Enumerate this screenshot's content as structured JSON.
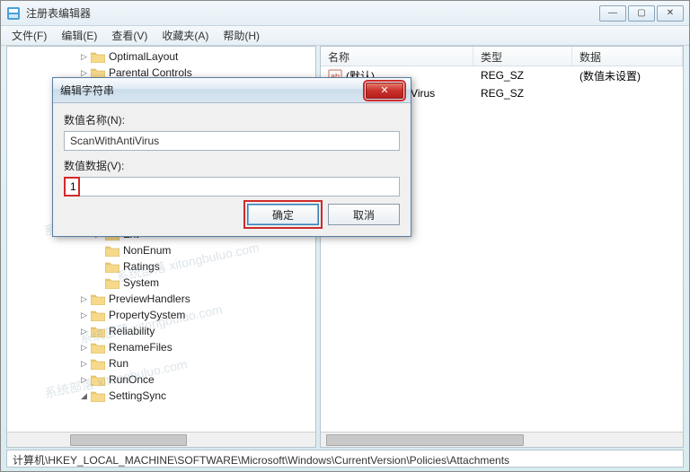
{
  "window": {
    "title": "注册表编辑器"
  },
  "window_controls": {
    "min": "—",
    "max": "▢",
    "close": "✕"
  },
  "menu": {
    "file": "文件(F)",
    "edit": "编辑(E)",
    "view": "查看(V)",
    "favorites": "收藏夹(A)",
    "help": "帮助(H)"
  },
  "tree": {
    "items": [
      {
        "indent": 5,
        "expander": "▷",
        "label": "OptimalLayout"
      },
      {
        "indent": 5,
        "expander": "▷",
        "label": "Parental Controls"
      },
      {
        "indent": 5,
        "expander": "▷",
        "label": ""
      },
      {
        "indent": 5,
        "expander": "▷",
        "label": ""
      },
      {
        "indent": 5,
        "expander": "▷",
        "label": ""
      },
      {
        "indent": 5,
        "expander": "▷",
        "label": ""
      },
      {
        "indent": 5,
        "expander": "▷",
        "label": ""
      },
      {
        "indent": 5,
        "expander": "▷",
        "label": ""
      },
      {
        "indent": 5,
        "expander": "▷",
        "label": ""
      },
      {
        "indent": 5,
        "expander": "▷",
        "label": ""
      },
      {
        "indent": 5,
        "expander": "▷",
        "label": ""
      },
      {
        "indent": 6,
        "expander": "▷",
        "label": "Ext"
      },
      {
        "indent": 6,
        "expander": "",
        "label": "NonEnum"
      },
      {
        "indent": 6,
        "expander": "",
        "label": "Ratings"
      },
      {
        "indent": 6,
        "expander": "",
        "label": "System"
      },
      {
        "indent": 5,
        "expander": "▷",
        "label": "PreviewHandlers"
      },
      {
        "indent": 5,
        "expander": "▷",
        "label": "PropertySystem"
      },
      {
        "indent": 5,
        "expander": "▷",
        "label": "Reliability"
      },
      {
        "indent": 5,
        "expander": "▷",
        "label": "RenameFiles"
      },
      {
        "indent": 5,
        "expander": "▷",
        "label": "Run"
      },
      {
        "indent": 5,
        "expander": "▷",
        "label": "RunOnce"
      },
      {
        "indent": 5,
        "expander": "◢",
        "label": "SettingSync"
      }
    ]
  },
  "list": {
    "headers": {
      "name": "名称",
      "type": "类型",
      "data": "数据"
    },
    "rows": [
      {
        "name": "(默认)",
        "type": "REG_SZ",
        "data": "(数值未设置)"
      },
      {
        "name": "ScanWithAntiVirus",
        "type": "REG_SZ",
        "data": ""
      }
    ]
  },
  "statusbar": {
    "path": "计算机\\HKEY_LOCAL_MACHINE\\SOFTWARE\\Microsoft\\Windows\\CurrentVersion\\Policies\\Attachments"
  },
  "dialog": {
    "title": "编辑字符串",
    "name_label": "数值名称(N):",
    "name_value": "ScanWithAntiVirus",
    "data_label": "数值数据(V):",
    "data_value": "1",
    "ok": "确定",
    "cancel": "取消",
    "close_x": "✕"
  },
  "watermark": "系统部落 xitongbuluo.com"
}
